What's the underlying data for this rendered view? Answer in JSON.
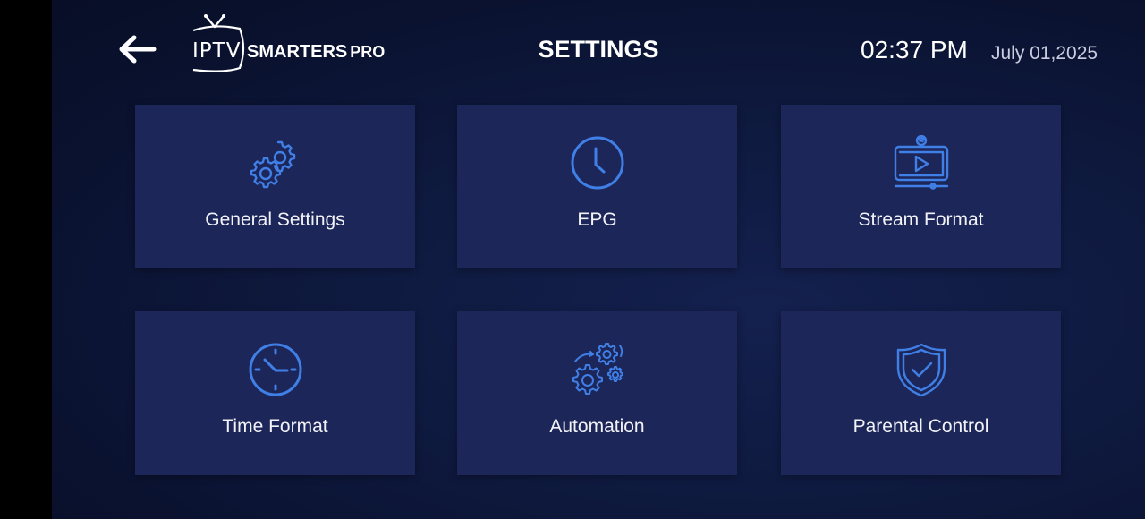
{
  "header": {
    "logo_iptv": "IPTV",
    "logo_smarters": "SMARTERS",
    "logo_pro": "PRO",
    "title": "SETTINGS",
    "time": "02:37 PM",
    "date": "July 01,2025",
    "back_icon": "arrow-left-icon"
  },
  "tiles": [
    {
      "label": "General Settings",
      "icon": "gears-icon"
    },
    {
      "label": "EPG",
      "icon": "clock-icon"
    },
    {
      "label": "Stream Format",
      "icon": "monitor-play-icon"
    },
    {
      "label": "Time Format",
      "icon": "clock-icon"
    },
    {
      "label": "Automation",
      "icon": "automation-gears-icon"
    },
    {
      "label": "Parental Control",
      "icon": "shield-check-icon"
    }
  ],
  "colors": {
    "accent": "#3f7fe6",
    "tile_bg": "#1d2659",
    "page_bg": "#0f1a40"
  }
}
